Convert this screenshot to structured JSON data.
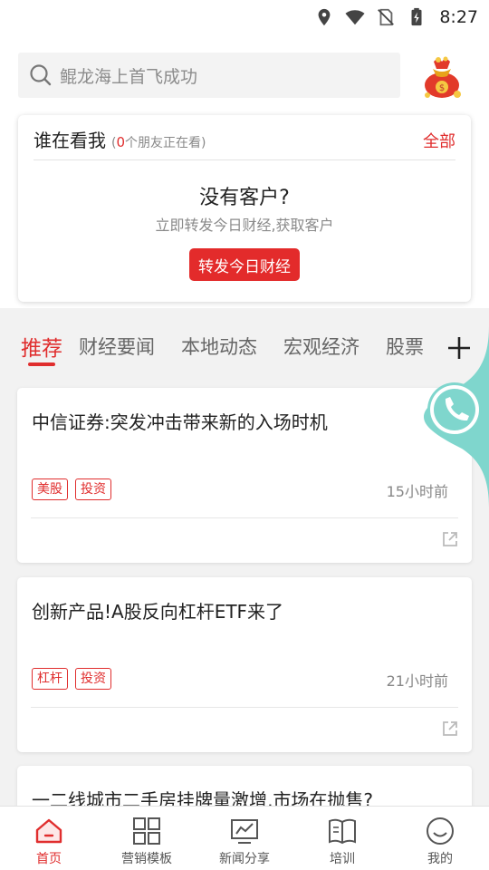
{
  "status_bar": {
    "time": "8:27",
    "icons": [
      "location-icon",
      "wifi-icon",
      "no-sim-icon",
      "battery-charging-icon"
    ]
  },
  "search": {
    "placeholder": "鲲龙海上首飞成功",
    "icon": "search-icon"
  },
  "viewer_card": {
    "title": "谁在看我",
    "sub_prefix": "(",
    "count": "0",
    "sub_suffix": "个朋友正在看)",
    "all_label": "全部",
    "empty_title": "没有客户?",
    "empty_sub": "立即转发今日财经,获取客户",
    "share_button": "转发今日财经"
  },
  "tabs": [
    {
      "label": "推荐",
      "active": true
    },
    {
      "label": "财经要闻",
      "active": false
    },
    {
      "label": "本地动态",
      "active": false
    },
    {
      "label": "宏观经济",
      "active": false
    },
    {
      "label": "股票",
      "active": false
    }
  ],
  "news": [
    {
      "title": "中信证券:突发冲击带来新的入场时机",
      "tags": [
        "美股",
        "投资"
      ],
      "time": "15小时前"
    },
    {
      "title": "创新产品!A股反向杠杆ETF来了",
      "tags": [
        "杠杆",
        "投资"
      ],
      "time": "21小时前"
    },
    {
      "title": "一二线城市二手房挂牌量激增,市场在抛售?",
      "tags": [],
      "time": ""
    }
  ],
  "bottom_nav": [
    {
      "label": "首页",
      "icon": "home-icon",
      "active": true
    },
    {
      "label": "营销模板",
      "icon": "template-grid-icon",
      "active": false
    },
    {
      "label": "新闻分享",
      "icon": "news-chart-icon",
      "active": false
    },
    {
      "label": "培训",
      "icon": "book-icon",
      "active": false
    },
    {
      "label": "我的",
      "icon": "profile-smile-icon",
      "active": false
    }
  ],
  "colors": {
    "accent": "#e02e2e",
    "float_button": "#7fd6cd"
  }
}
